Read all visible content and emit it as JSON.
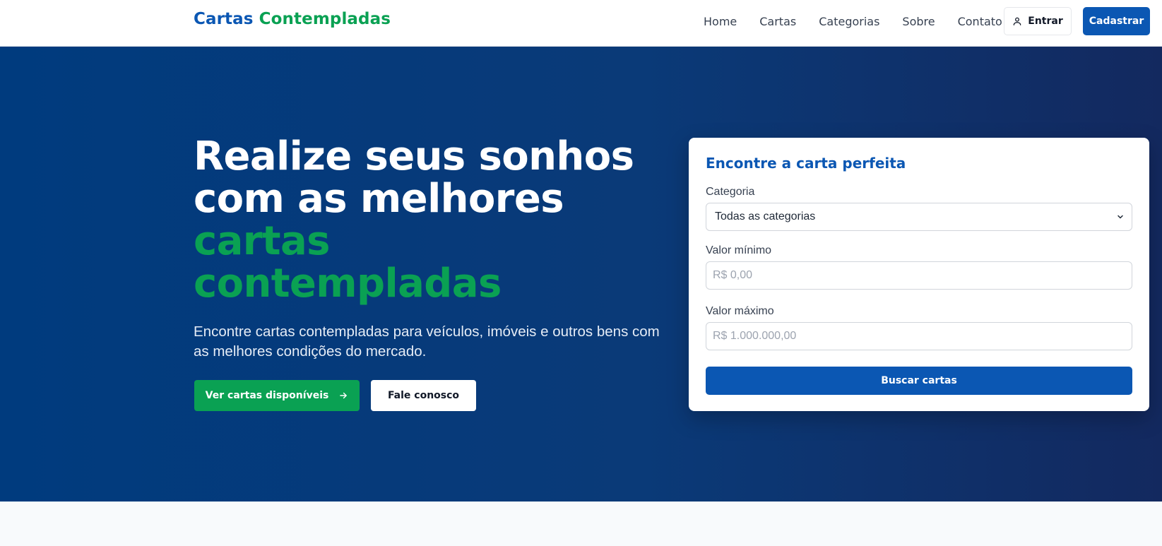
{
  "brand": {
    "part1": "Cartas",
    "part2": "Contempladas"
  },
  "nav": {
    "items": [
      "Home",
      "Cartas",
      "Categorias",
      "Sobre",
      "Contato"
    ]
  },
  "auth": {
    "login_label": "Entrar",
    "signup_label": "Cadastrar"
  },
  "hero": {
    "headline_line1": "Realize seus sonhos",
    "headline_line2": "com as melhores",
    "headline_green_line1": "cartas",
    "headline_green_line2": "contempladas",
    "subtitle": "Encontre cartas contempladas para veículos, imóveis e outros bens com as melhores condições do mercado.",
    "primary_button": "Ver cartas disponíveis",
    "secondary_button": "Fale conosco"
  },
  "search": {
    "title": "Encontre a carta perfeita",
    "category_label": "Categoria",
    "category_value": "Todas as categorias",
    "min_label": "Valor mínimo",
    "min_placeholder": "R$ 0,00",
    "max_label": "Valor máximo",
    "max_placeholder": "R$ 1.000.000,00",
    "submit_label": "Buscar cartas"
  },
  "colors": {
    "brand_blue": "#0b57b3",
    "brand_green": "#0aa153",
    "hero_bg": "#003b7e"
  },
  "icons": {
    "login": "user-icon",
    "arrow": "arrow-right-icon",
    "select": "chevron-down-icon"
  }
}
